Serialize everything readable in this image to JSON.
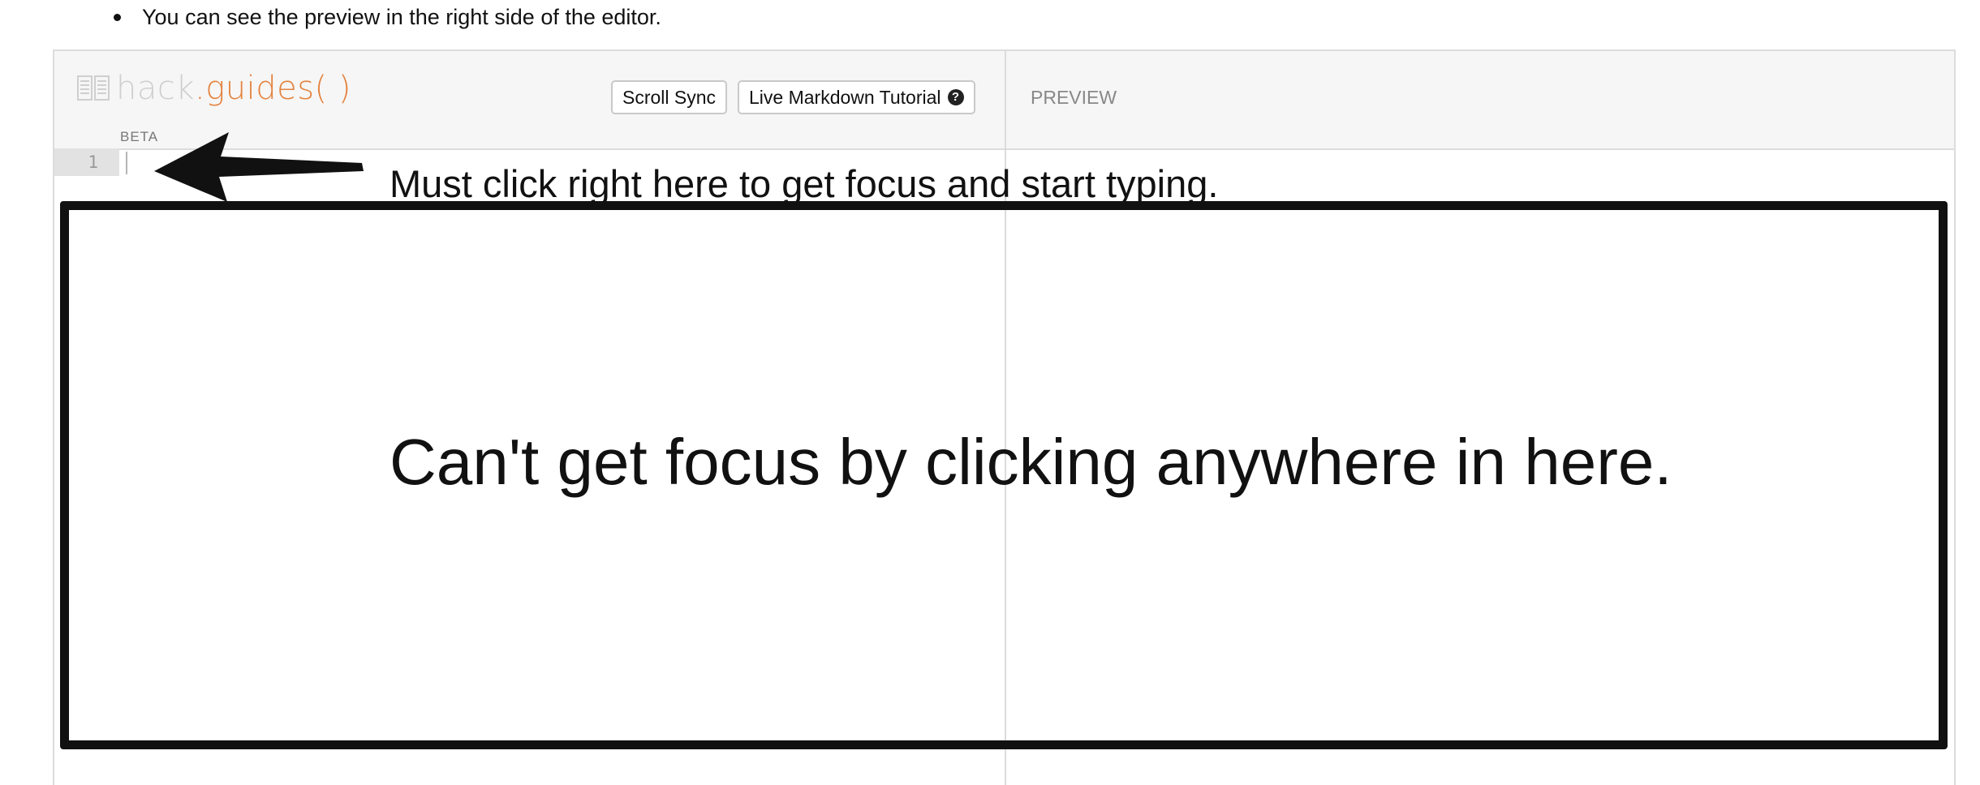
{
  "bullet": {
    "text": "You can see the preview in the right side of the editor."
  },
  "editor": {
    "logo": {
      "icon": "book-icon",
      "hack": "hack",
      "dot": ".",
      "guides": "guides( )",
      "badge": "BETA",
      "colors": {
        "hack": "#cfcfcf",
        "guides": "#e4833f"
      }
    },
    "toolbar": {
      "scroll_sync_label": "Scroll Sync",
      "tutorial_label": "Live Markdown Tutorial",
      "tutorial_icon": "question-circle-icon"
    },
    "preview_label": "PREVIEW",
    "gutter": {
      "line_number": "1"
    }
  },
  "annotations": {
    "arrow_note": "Must click right here to get focus and start typing.",
    "box_note": "Can't get focus by clicking anywhere in here."
  }
}
